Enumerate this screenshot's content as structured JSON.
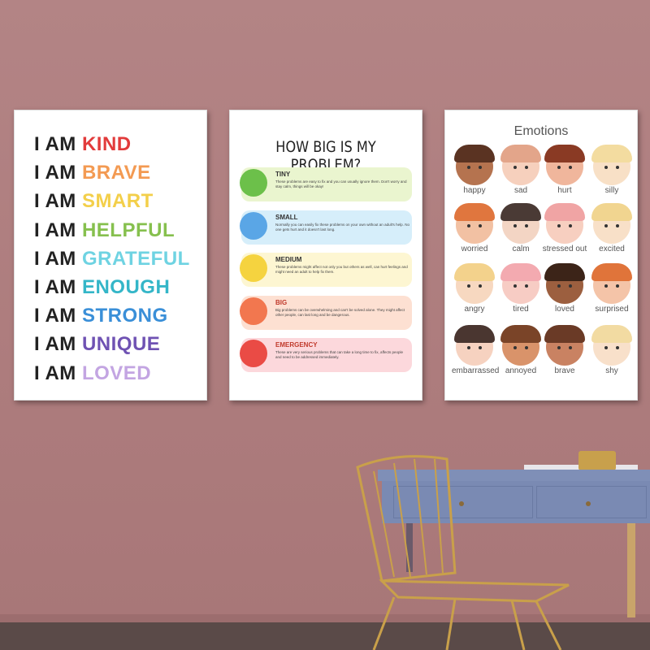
{
  "poster_affirmations": {
    "prefix": "I AM",
    "words": [
      {
        "word": "KIND",
        "color": "#e23b3b"
      },
      {
        "word": "BRAVE",
        "color": "#f39a52"
      },
      {
        "word": "SMART",
        "color": "#f3cf4a"
      },
      {
        "word": "HELPFUL",
        "color": "#86c04e"
      },
      {
        "word": "GRATEFUL",
        "color": "#6fd3e2"
      },
      {
        "word": "ENOUGH",
        "color": "#34b6c8"
      },
      {
        "word": "STRONG",
        "color": "#3a8fd8"
      },
      {
        "word": "UNIQUE",
        "color": "#6f52b3"
      },
      {
        "word": "LOVED",
        "color": "#c3a5e2"
      }
    ]
  },
  "poster_problem": {
    "title": "HOW BIG IS MY PROBLEM?",
    "levels": [
      {
        "name": "TINY",
        "text": "These problems are easy to fix and you can usually ignore them. Don't worry and stay calm, things will be okay!",
        "band": "#eaf5cf",
        "face": "#6cc04a",
        "title_color": "#333"
      },
      {
        "name": "SMALL",
        "text": "Normally you can easily fix these problems on your own without an adult's help. No one gets hurt and it doesn't last long.",
        "band": "#d6eefa",
        "face": "#5aa6e6",
        "title_color": "#333"
      },
      {
        "name": "MEDIUM",
        "text": "These problems might affect not only you but others as well, can hurt feelings and might need an adult to help fix them.",
        "band": "#fdf6d2",
        "face": "#f5d33f",
        "title_color": "#333"
      },
      {
        "name": "BIG",
        "text": "Big problems can be overwhelming and can't be solved alone. They might affect other people, can last long and be dangerous.",
        "band": "#fde0d2",
        "face": "#f2774f",
        "title_color": "#c0392b"
      },
      {
        "name": "EMERGENCY",
        "text": "These are very serious problems that can take a long time to fix, affects people and need to be addressed immediately.",
        "band": "#fcd8dc",
        "face": "#ea4b45",
        "title_color": "#c0392b"
      }
    ]
  },
  "poster_emotions": {
    "title": "Emotions",
    "items": [
      {
        "label": "happy",
        "skin": "#b5734f",
        "hair": "#5a3322"
      },
      {
        "label": "sad",
        "skin": "#f6d0bd",
        "hair": "#e3a58a"
      },
      {
        "label": "hurt",
        "skin": "#f0b69c",
        "hair": "#8a3a24"
      },
      {
        "label": "silly",
        "skin": "#f8e0c6",
        "hair": "#f3dca0"
      },
      {
        "label": "worried",
        "skin": "#f2c1a3",
        "hair": "#e0763e"
      },
      {
        "label": "calm",
        "skin": "#f3d5c4",
        "hair": "#4a3a35"
      },
      {
        "label": "stressed out",
        "skin": "#f7cfc0",
        "hair": "#f0a4a4"
      },
      {
        "label": "excited",
        "skin": "#f8e0c8",
        "hair": "#f1d590"
      },
      {
        "label": "angry",
        "skin": "#f7d8c0",
        "hair": "#f3d28c"
      },
      {
        "label": "tired",
        "skin": "#f7ccc4",
        "hair": "#f3aab0"
      },
      {
        "label": "loved",
        "skin": "#9c5f3f",
        "hair": "#3c2418"
      },
      {
        "label": "surprised",
        "skin": "#f4c4a8",
        "hair": "#e0743a"
      },
      {
        "label": "embarrassed",
        "skin": "#f6d2c0",
        "hair": "#4a3630"
      },
      {
        "label": "annoyed",
        "skin": "#d9936a",
        "hair": "#7a4428"
      },
      {
        "label": "brave",
        "skin": "#c98262",
        "hair": "#6a3a26"
      },
      {
        "label": "shy",
        "skin": "#f8e0ca",
        "hair": "#f2dba2"
      }
    ]
  }
}
